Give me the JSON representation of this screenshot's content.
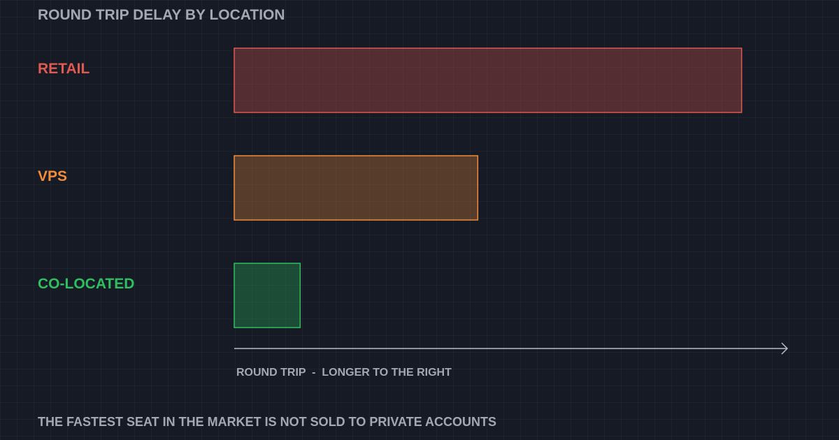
{
  "chart_data": {
    "type": "bar",
    "orientation": "horizontal",
    "title": "ROUND TRIP DELAY BY LOCATION",
    "categories": [
      "RETAIL",
      "VPS",
      "CO-LOCATED"
    ],
    "values": [
      100,
      48,
      13
    ],
    "colors": [
      "#e05a52",
      "#f08c3a",
      "#2fbf60"
    ],
    "xlabel": "ROUND TRIP  -  LONGER TO THE RIGHT",
    "xlim": [
      0,
      109
    ],
    "axis_ticks": "none",
    "grid": true
  },
  "footer_text": "THE FASTEST SEAT IN THE MARKET IS NOT SOLD TO PRIVATE ACCOUNTS"
}
